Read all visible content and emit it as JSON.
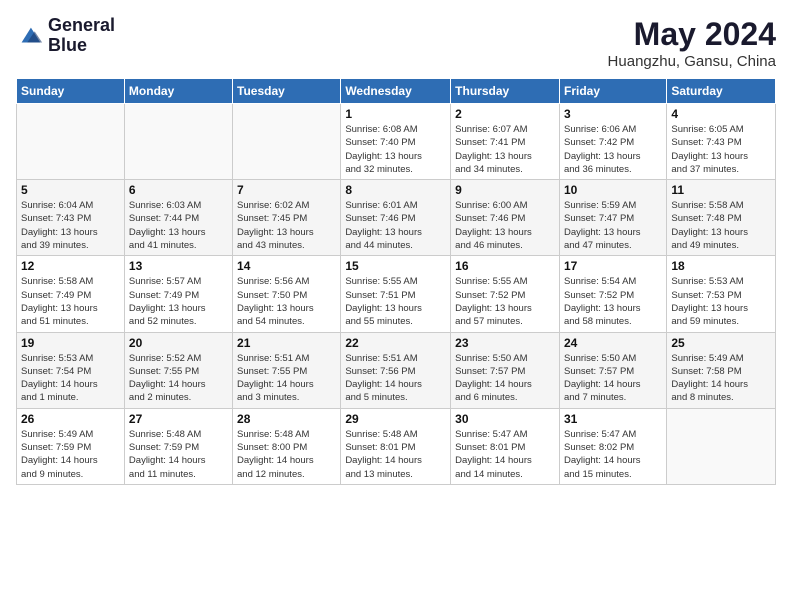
{
  "logo": {
    "line1": "General",
    "line2": "Blue"
  },
  "title": "May 2024",
  "subtitle": "Huangzhu, Gansu, China",
  "days_header": [
    "Sunday",
    "Monday",
    "Tuesday",
    "Wednesday",
    "Thursday",
    "Friday",
    "Saturday"
  ],
  "weeks": [
    [
      {
        "day": "",
        "info": ""
      },
      {
        "day": "",
        "info": ""
      },
      {
        "day": "",
        "info": ""
      },
      {
        "day": "1",
        "info": "Sunrise: 6:08 AM\nSunset: 7:40 PM\nDaylight: 13 hours\nand 32 minutes."
      },
      {
        "day": "2",
        "info": "Sunrise: 6:07 AM\nSunset: 7:41 PM\nDaylight: 13 hours\nand 34 minutes."
      },
      {
        "day": "3",
        "info": "Sunrise: 6:06 AM\nSunset: 7:42 PM\nDaylight: 13 hours\nand 36 minutes."
      },
      {
        "day": "4",
        "info": "Sunrise: 6:05 AM\nSunset: 7:43 PM\nDaylight: 13 hours\nand 37 minutes."
      }
    ],
    [
      {
        "day": "5",
        "info": "Sunrise: 6:04 AM\nSunset: 7:43 PM\nDaylight: 13 hours\nand 39 minutes."
      },
      {
        "day": "6",
        "info": "Sunrise: 6:03 AM\nSunset: 7:44 PM\nDaylight: 13 hours\nand 41 minutes."
      },
      {
        "day": "7",
        "info": "Sunrise: 6:02 AM\nSunset: 7:45 PM\nDaylight: 13 hours\nand 43 minutes."
      },
      {
        "day": "8",
        "info": "Sunrise: 6:01 AM\nSunset: 7:46 PM\nDaylight: 13 hours\nand 44 minutes."
      },
      {
        "day": "9",
        "info": "Sunrise: 6:00 AM\nSunset: 7:46 PM\nDaylight: 13 hours\nand 46 minutes."
      },
      {
        "day": "10",
        "info": "Sunrise: 5:59 AM\nSunset: 7:47 PM\nDaylight: 13 hours\nand 47 minutes."
      },
      {
        "day": "11",
        "info": "Sunrise: 5:58 AM\nSunset: 7:48 PM\nDaylight: 13 hours\nand 49 minutes."
      }
    ],
    [
      {
        "day": "12",
        "info": "Sunrise: 5:58 AM\nSunset: 7:49 PM\nDaylight: 13 hours\nand 51 minutes."
      },
      {
        "day": "13",
        "info": "Sunrise: 5:57 AM\nSunset: 7:49 PM\nDaylight: 13 hours\nand 52 minutes."
      },
      {
        "day": "14",
        "info": "Sunrise: 5:56 AM\nSunset: 7:50 PM\nDaylight: 13 hours\nand 54 minutes."
      },
      {
        "day": "15",
        "info": "Sunrise: 5:55 AM\nSunset: 7:51 PM\nDaylight: 13 hours\nand 55 minutes."
      },
      {
        "day": "16",
        "info": "Sunrise: 5:55 AM\nSunset: 7:52 PM\nDaylight: 13 hours\nand 57 minutes."
      },
      {
        "day": "17",
        "info": "Sunrise: 5:54 AM\nSunset: 7:52 PM\nDaylight: 13 hours\nand 58 minutes."
      },
      {
        "day": "18",
        "info": "Sunrise: 5:53 AM\nSunset: 7:53 PM\nDaylight: 13 hours\nand 59 minutes."
      }
    ],
    [
      {
        "day": "19",
        "info": "Sunrise: 5:53 AM\nSunset: 7:54 PM\nDaylight: 14 hours\nand 1 minute."
      },
      {
        "day": "20",
        "info": "Sunrise: 5:52 AM\nSunset: 7:55 PM\nDaylight: 14 hours\nand 2 minutes."
      },
      {
        "day": "21",
        "info": "Sunrise: 5:51 AM\nSunset: 7:55 PM\nDaylight: 14 hours\nand 3 minutes."
      },
      {
        "day": "22",
        "info": "Sunrise: 5:51 AM\nSunset: 7:56 PM\nDaylight: 14 hours\nand 5 minutes."
      },
      {
        "day": "23",
        "info": "Sunrise: 5:50 AM\nSunset: 7:57 PM\nDaylight: 14 hours\nand 6 minutes."
      },
      {
        "day": "24",
        "info": "Sunrise: 5:50 AM\nSunset: 7:57 PM\nDaylight: 14 hours\nand 7 minutes."
      },
      {
        "day": "25",
        "info": "Sunrise: 5:49 AM\nSunset: 7:58 PM\nDaylight: 14 hours\nand 8 minutes."
      }
    ],
    [
      {
        "day": "26",
        "info": "Sunrise: 5:49 AM\nSunset: 7:59 PM\nDaylight: 14 hours\nand 9 minutes."
      },
      {
        "day": "27",
        "info": "Sunrise: 5:48 AM\nSunset: 7:59 PM\nDaylight: 14 hours\nand 11 minutes."
      },
      {
        "day": "28",
        "info": "Sunrise: 5:48 AM\nSunset: 8:00 PM\nDaylight: 14 hours\nand 12 minutes."
      },
      {
        "day": "29",
        "info": "Sunrise: 5:48 AM\nSunset: 8:01 PM\nDaylight: 14 hours\nand 13 minutes."
      },
      {
        "day": "30",
        "info": "Sunrise: 5:47 AM\nSunset: 8:01 PM\nDaylight: 14 hours\nand 14 minutes."
      },
      {
        "day": "31",
        "info": "Sunrise: 5:47 AM\nSunset: 8:02 PM\nDaylight: 14 hours\nand 15 minutes."
      },
      {
        "day": "",
        "info": ""
      }
    ]
  ]
}
